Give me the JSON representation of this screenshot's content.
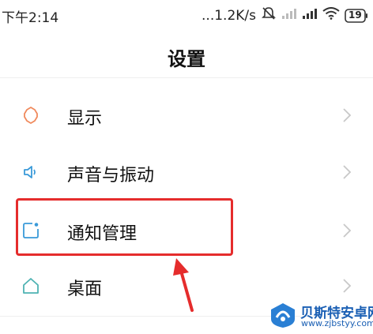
{
  "status_bar": {
    "time": "下午2:14",
    "net_speed": "...1.2K/s",
    "battery": "19",
    "icons": [
      "mute-icon",
      "signal-weak-icon",
      "signal-icon",
      "wifi-icon",
      "battery-icon"
    ]
  },
  "header": {
    "title": "设置"
  },
  "settings_list": [
    {
      "label": "显示",
      "icon": "brightness-icon",
      "icon_color": "#f08a5d"
    },
    {
      "label": "声音与振动",
      "icon": "speaker-icon",
      "icon_color": "#3a9ad9"
    },
    {
      "label": "通知管理",
      "icon": "notification-icon",
      "icon_color": "#3a9ad9"
    },
    {
      "label": "桌面",
      "icon": "home-icon",
      "icon_color": "#4fb3b3"
    }
  ],
  "annotation": {
    "highlight_color": "#e52c2c"
  },
  "watermark": {
    "title": "贝斯特安卓网",
    "url": "www.zjbstyy.com"
  }
}
